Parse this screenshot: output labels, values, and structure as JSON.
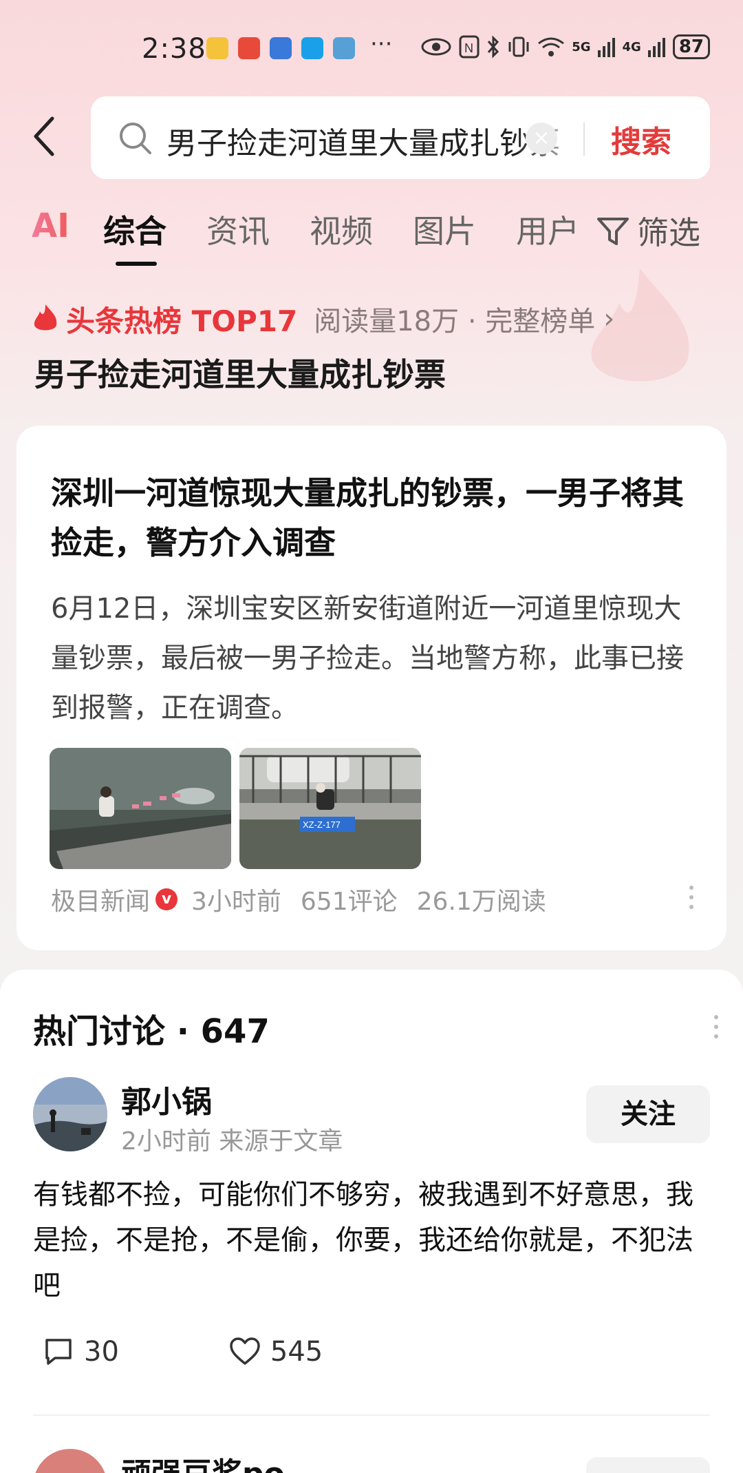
{
  "status_bar": {
    "time": "2:38",
    "dots": "···",
    "net1": "5G",
    "net2": "4G",
    "battery": "87"
  },
  "search": {
    "query": "男子捡走河道里大量成扎钞票",
    "button_label": "搜索"
  },
  "tabs": {
    "ai_label": "AI",
    "items": [
      "综合",
      "资讯",
      "视频",
      "图片",
      "用户"
    ],
    "filter_label": "筛选"
  },
  "hot_board": {
    "title": "头条热榜 TOP17",
    "meta": "阅读量18万 · 完整榜单",
    "chevron": "›",
    "headline": "男子捡走河道里大量成扎钞票"
  },
  "article": {
    "title": "深圳一河道惊现大量成扎的钞票，一男子将其捡走，警方介入调查",
    "summary": "6月12日，深圳宝安区新安街道附近一河道里惊现大量钞票，最后被一男子捡走。当地警方称，此事已接到报警，正在调查。",
    "source": "极目新闻",
    "verified_badge": "v",
    "time": "3小时前",
    "comments": "651评论",
    "reads": "26.1万阅读",
    "thumb2_sign": "XZ-Z-177"
  },
  "discussion": {
    "title": "热门讨论 · 647",
    "comment1": {
      "user": "郭小锅",
      "meta": "2小时前  来源于文章",
      "follow_label": "关注",
      "text": "有钱都不捡，可能你们不够穷，被我遇到不好意思，我是捡，不是抢，不是偷，你要，我还给你就是，不犯法吧",
      "reply_count": "30",
      "like_count": "545"
    },
    "comment2": {
      "user": "顽强豆浆po"
    }
  },
  "colors": {
    "accent_red": "#e33b3b",
    "hot_red": "#e8363a"
  }
}
